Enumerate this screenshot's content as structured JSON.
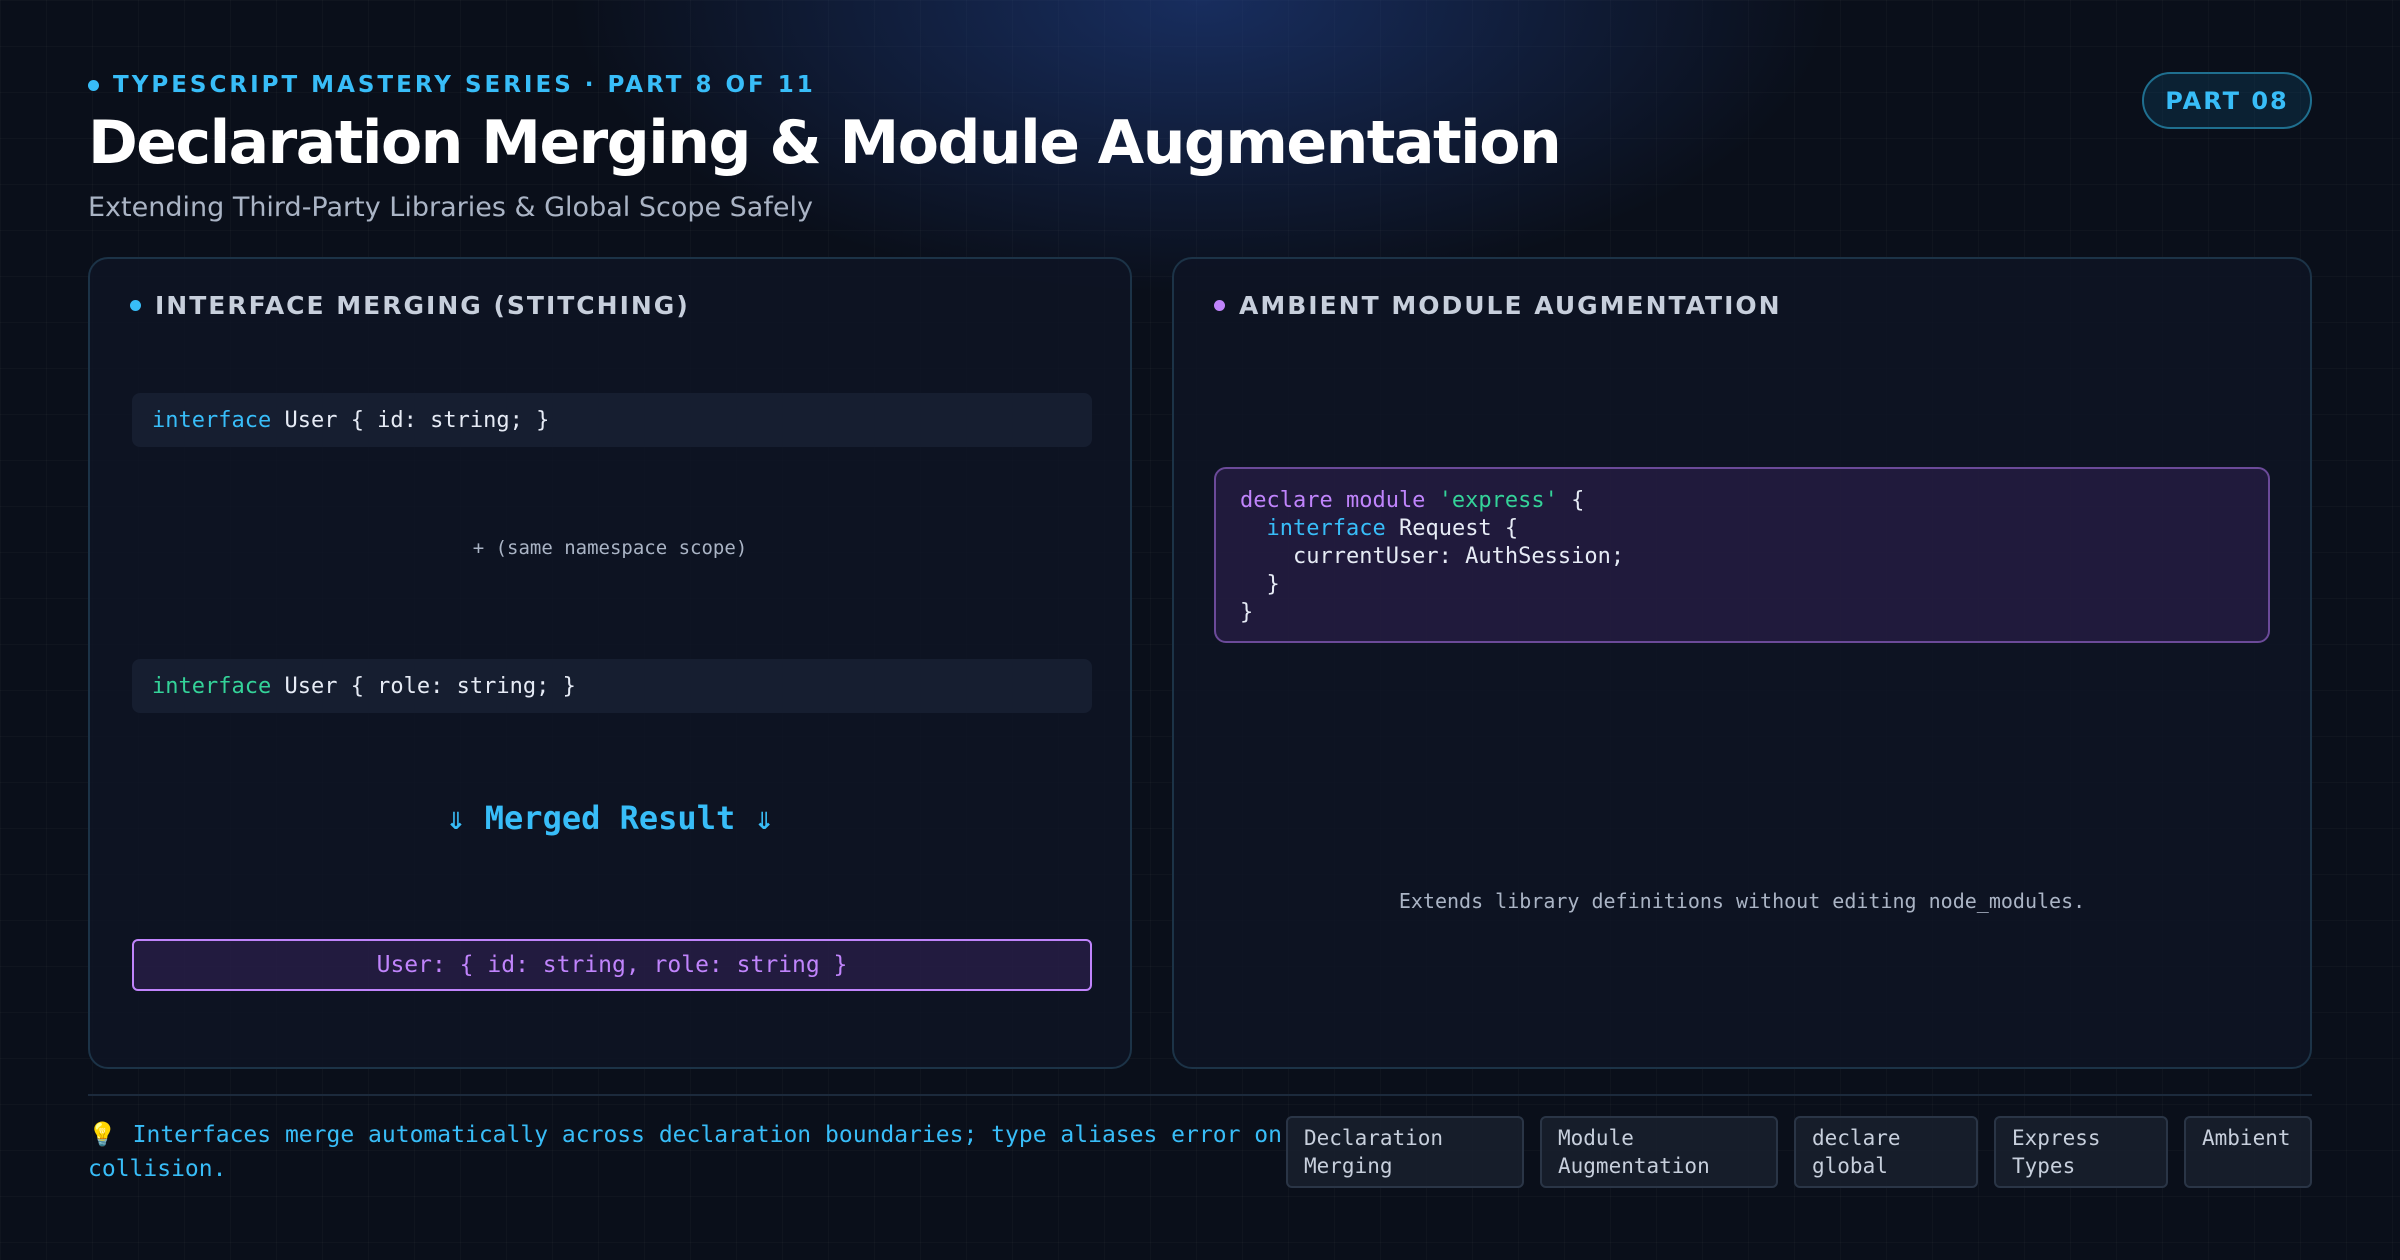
{
  "header": {
    "eyebrow": "TYPESCRIPT MASTERY SERIES · PART 8 OF 11",
    "title": "Declaration Merging & Module Augmentation",
    "subtitle": "Extending Third-Party Libraries & Global Scope Safely",
    "badge": "PART 08"
  },
  "left_panel": {
    "label": "INTERFACE MERGING (STITCHING)",
    "line1_keyword": "interface",
    "line1_rest": " User { id: string; }",
    "scope_note": "+ (same namespace scope)",
    "line2_keyword": "interface",
    "line2_rest": " User { role: string; }",
    "merged_heading": "⇓ Merged Result ⇓",
    "merged_result": "User: { id: string, role: string }"
  },
  "right_panel": {
    "label": "AMBIENT MODULE AUGMENTATION",
    "code": {
      "l1_declare": "declare module",
      "l1_string": "'express'",
      "l1_brace": " {",
      "l2_keyword": "interface",
      "l2_rest": " Request {",
      "l3": "    currentUser: AuthSession;",
      "l4": "  }",
      "l5": "}"
    },
    "extends_note": "Extends library definitions without editing node_modules."
  },
  "footer": {
    "tip_icon": "💡",
    "tip": "Interfaces merge automatically across declaration boundaries; type aliases error on collision.",
    "tags": [
      {
        "line1": "Declaration",
        "line2": "Merging"
      },
      {
        "line1": "Module",
        "line2": "Augmentation"
      },
      {
        "line1": "declare",
        "line2": "global"
      },
      {
        "line1": "Express",
        "line2": "Types"
      },
      {
        "line1": "Ambient",
        "line2": ""
      }
    ]
  },
  "colors": {
    "accent_blue": "#38bdf8",
    "accent_purple": "#c084fc",
    "accent_green": "#34d399",
    "background": "#0a0f1a"
  }
}
